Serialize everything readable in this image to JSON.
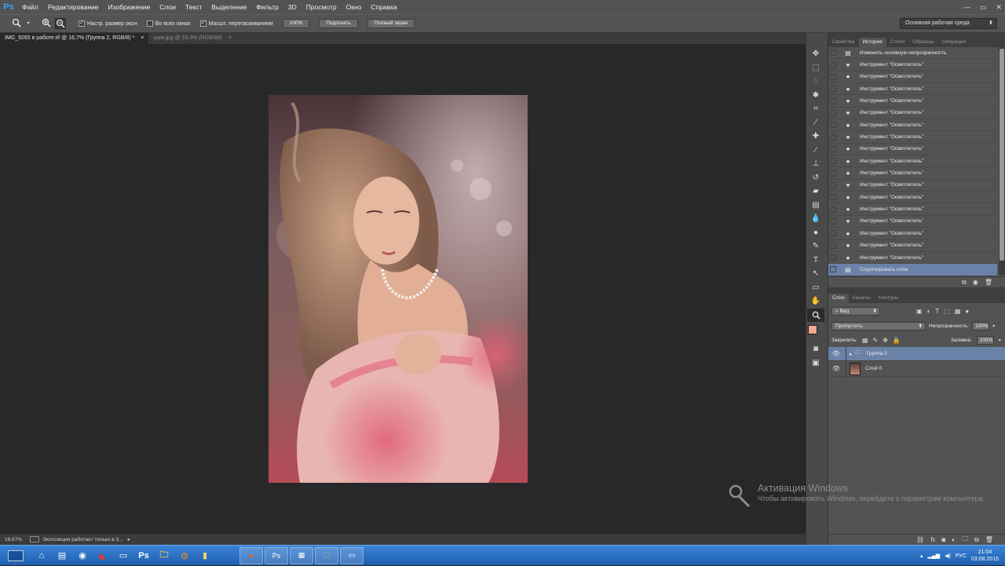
{
  "app": {
    "logo": "Ps",
    "menu": [
      "Файл",
      "Редактирование",
      "Изображение",
      "Слои",
      "Текст",
      "Выделение",
      "Фильтр",
      "3D",
      "Просмотр",
      "Окно",
      "Справка"
    ],
    "window_controls": [
      "—",
      "▭",
      "✕"
    ]
  },
  "options_bar": {
    "resize_windows": "Настр. размер окон",
    "all_windows": "Во всех окнах",
    "scrubby_zoom": "Масшт. перетаскиванием",
    "btn_100": "100%",
    "btn_fit": "Подогнать",
    "btn_fill": "Полный экран",
    "workspace": "Основная рабочая среда"
  },
  "tabs": [
    {
      "label": "IMG_9265 в работе.tif @ 16,7% (Группа 2, RGB/8) *",
      "close": "×"
    },
    {
      "label": "шум.jpg @ 33,3% (RGB/8#)",
      "close": "×"
    }
  ],
  "status": {
    "zoom": "16,67%",
    "message": "Экспозиция работает только в 3...",
    "arrow": "▸"
  },
  "history_panel": {
    "tabs": [
      "Свойства",
      "История",
      "Стили",
      "Образцы",
      "Операция"
    ],
    "active_tab": 1,
    "rows": [
      {
        "label": "Изменить основную непрозрачность",
        "icon": "doc"
      },
      {
        "label": "Инструмент \"Осветлитель\"",
        "icon": "dodge"
      },
      {
        "label": "Инструмент \"Осветлитель\"",
        "icon": "dodge"
      },
      {
        "label": "Инструмент \"Осветлитель\"",
        "icon": "dodge"
      },
      {
        "label": "Инструмент \"Осветлитель\"",
        "icon": "dodge"
      },
      {
        "label": "Инструмент \"Осветлитель\"",
        "icon": "dodge"
      },
      {
        "label": "Инструмент \"Осветлитель\"",
        "icon": "dodge"
      },
      {
        "label": "Инструмент \"Осветлитель\"",
        "icon": "dodge"
      },
      {
        "label": "Инструмент \"Осветлитель\"",
        "icon": "dodge"
      },
      {
        "label": "Инструмент \"Осветлитель\"",
        "icon": "dodge"
      },
      {
        "label": "Инструмент \"Осветлитель\"",
        "icon": "dodge"
      },
      {
        "label": "Инструмент \"Осветлитель\"",
        "icon": "dodge"
      },
      {
        "label": "Инструмент \"Осветлитель\"",
        "icon": "dodge"
      },
      {
        "label": "Инструмент \"Осветлитель\"",
        "icon": "dodge"
      },
      {
        "label": "Инструмент \"Осветлитель\"",
        "icon": "dodge"
      },
      {
        "label": "Инструмент \"Осветлитель\"",
        "icon": "dodge"
      },
      {
        "label": "Инструмент \"Осветлитель\"",
        "icon": "dodge"
      },
      {
        "label": "Инструмент \"Осветлитель\"",
        "icon": "dodge"
      },
      {
        "label": "Сгруппировать слои",
        "icon": "doc",
        "selected": true
      }
    ]
  },
  "layers_panel": {
    "tabs": [
      "Слои",
      "Каналы",
      "Контуры"
    ],
    "filter": "Вид",
    "blend_mode": "Пропустить",
    "opacity_label": "Непрозрачность:",
    "opacity": "100%",
    "lock_label": "Закрепить:",
    "fill_label": "Заливка:",
    "fill": "100%",
    "layers": [
      {
        "name": "Группа 2",
        "type": "group",
        "selected": true
      },
      {
        "name": "Слой 0",
        "type": "pixel",
        "selected": false
      }
    ]
  },
  "activation": {
    "title": "Активация Windows",
    "subtitle": "Чтобы активировать Windows, перейдите к параметрам компьютера."
  },
  "taskbar": {
    "lang": "РУС",
    "time": "21:04",
    "date": "03.08.2015"
  },
  "colors": {
    "foreground": "#f0a890",
    "background": "#ffffff",
    "selection": "#6b82a8"
  }
}
